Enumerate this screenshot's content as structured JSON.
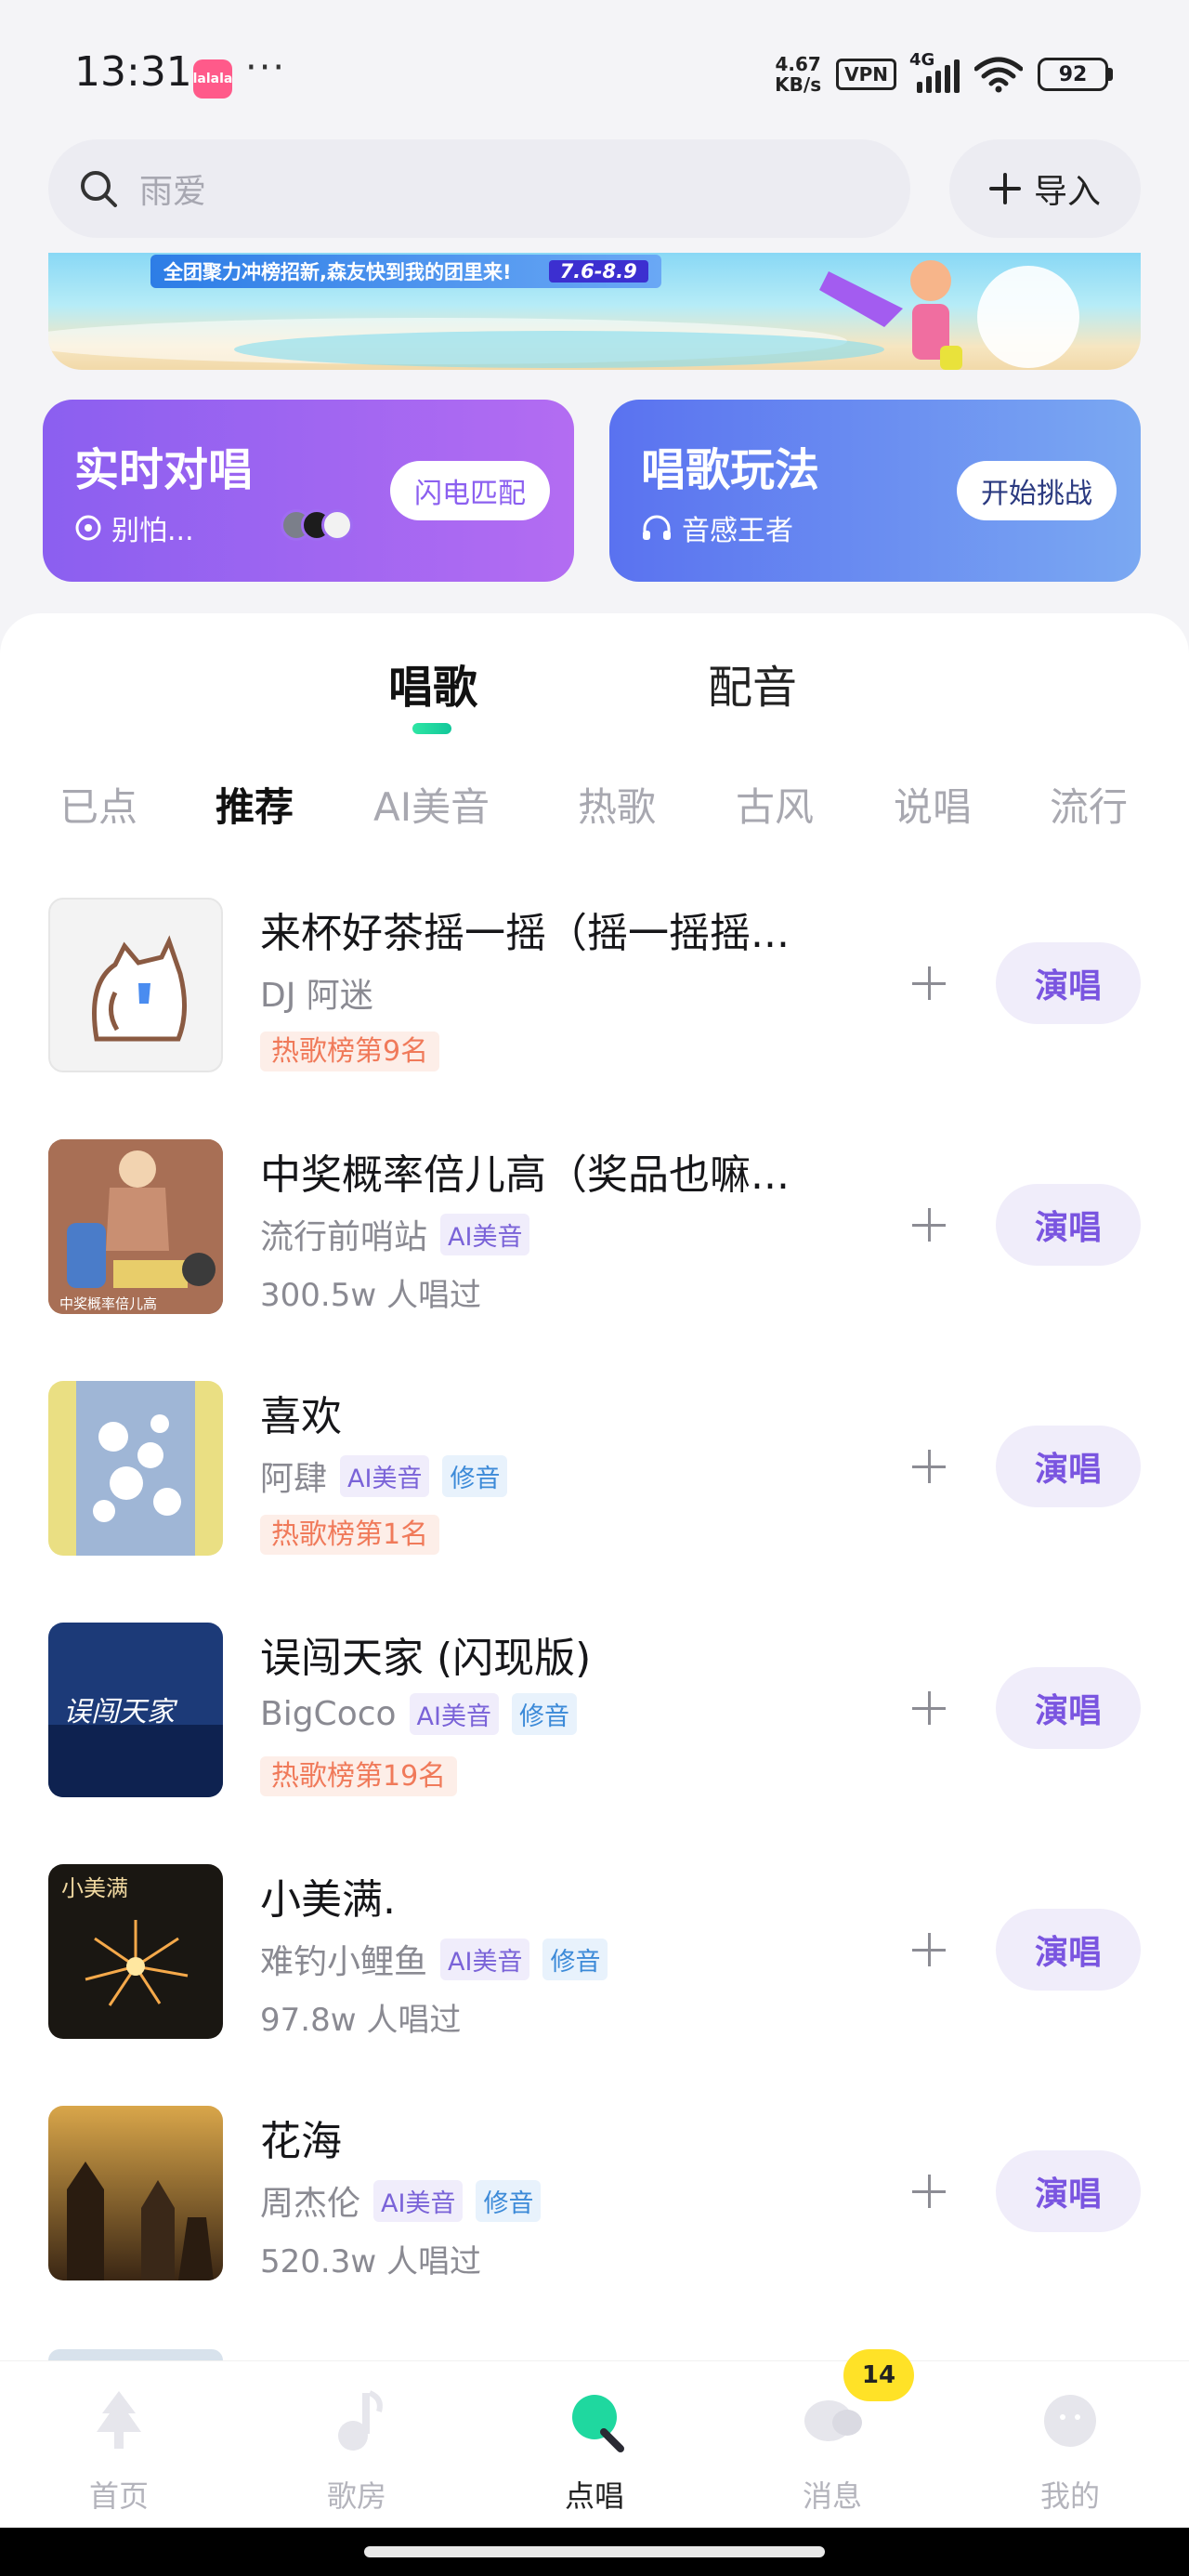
{
  "status_bar": {
    "time": "13:31",
    "app_icon_text": "lalala",
    "more": "···",
    "net_speed_value": "4.67",
    "net_speed_unit": "KB/s",
    "vpn": "VPN",
    "network": "4G",
    "battery": "92"
  },
  "search": {
    "placeholder": "雨爱",
    "import_label": "导入"
  },
  "banner": {
    "text": "全团聚力冲榜招新,森友快到我的团里来!",
    "date": "7.6-8.9"
  },
  "cards": {
    "duet": {
      "title": "实时对唱",
      "subtitle": "别怕...",
      "button": "闪电匹配"
    },
    "game": {
      "title": "唱歌玩法",
      "subtitle": "音感王者",
      "button": "开始挑战"
    }
  },
  "main_tabs": [
    {
      "label": "唱歌"
    },
    {
      "label": "配音"
    }
  ],
  "sub_tabs": [
    {
      "label": "已点"
    },
    {
      "label": "推荐"
    },
    {
      "label": "AI美音"
    },
    {
      "label": "热歌"
    },
    {
      "label": "古风"
    },
    {
      "label": "说唱"
    },
    {
      "label": "流行"
    }
  ],
  "tag_labels": {
    "ai": "AI美音",
    "fix": "修音"
  },
  "songs": [
    {
      "title": "来杯好茶摇一摇（摇一摇摇...",
      "artist": "DJ 阿迷",
      "rank": "热歌榜第9名",
      "sung": "",
      "cover_text": ""
    },
    {
      "title": "中奖概率倍儿高（奖品也嘛...",
      "artist": "流行前哨站",
      "rank": "",
      "sung": "300.5w 人唱过",
      "cover_text": "中奖概率倍儿高"
    },
    {
      "title": "喜欢",
      "artist": "阿肆",
      "rank": "热歌榜第1名",
      "sung": "",
      "cover_text": ""
    },
    {
      "title": "误闯天家 (闪现版)",
      "artist": "BigCoco",
      "rank": "热歌榜第19名",
      "sung": "",
      "cover_text": "误闯天家"
    },
    {
      "title": "小美满.",
      "artist": "难钓小鲤鱼",
      "rank": "",
      "sung": "97.8w 人唱过",
      "cover_text": "小美满"
    },
    {
      "title": "花海",
      "artist": "周杰伦",
      "rank": "",
      "sung": "520.3w 人唱过",
      "cover_text": ""
    }
  ],
  "sing_label": "演唱",
  "nav": [
    {
      "label": "首页"
    },
    {
      "label": "歌房"
    },
    {
      "label": "点唱"
    },
    {
      "label": "消息"
    },
    {
      "label": "我的"
    }
  ],
  "nav_badge": "14",
  "colors": {
    "accent_green": "#1fd89f",
    "purple": "#7a55e0",
    "rank_orange": "#f07a5a"
  }
}
